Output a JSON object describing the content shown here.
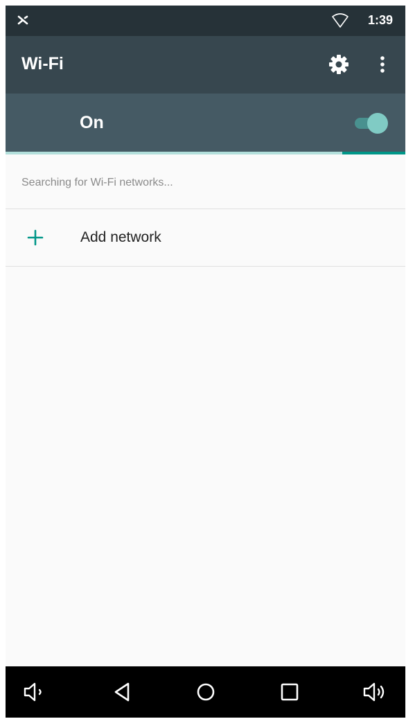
{
  "status_bar": {
    "left_icon": "x-notification-icon",
    "wifi_icon": "wifi-signal-icon",
    "time": "1:39"
  },
  "toolbar": {
    "title": "Wi-Fi",
    "settings_icon": "gear-icon",
    "overflow_icon": "more-vert-icon"
  },
  "switch_bar": {
    "label": "On",
    "toggle_on": true,
    "accent_color": "#80cbc4"
  },
  "list": {
    "status_text": "Searching for Wi-Fi networks...",
    "add_network": {
      "icon": "plus-icon",
      "label": "Add network"
    }
  },
  "nav_bar": {
    "buttons": [
      {
        "icon": "volume-down-icon"
      },
      {
        "icon": "back-icon"
      },
      {
        "icon": "home-icon"
      },
      {
        "icon": "recents-icon"
      },
      {
        "icon": "volume-up-icon"
      }
    ]
  },
  "colors": {
    "status_bar": "#263238",
    "toolbar": "#37474f",
    "switch_bar": "#455a64",
    "accent": "#009688"
  }
}
